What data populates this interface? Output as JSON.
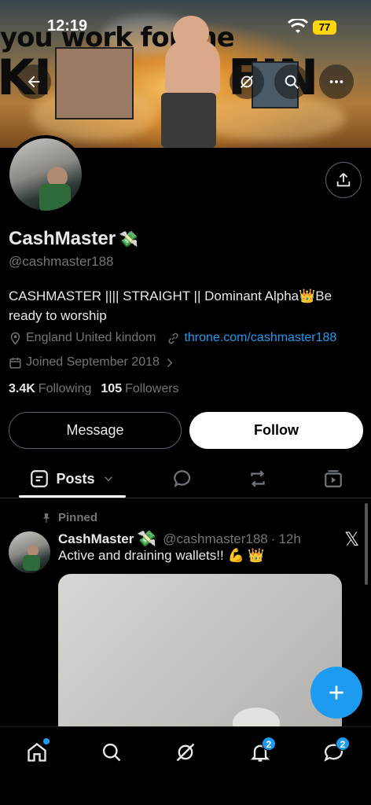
{
  "status_bar": {
    "time": "12:19",
    "battery": "77"
  },
  "banner": {
    "text_top": "you work for me",
    "text_left": "KING",
    "text_right": "FIN"
  },
  "profile": {
    "display_name": "CashMaster",
    "name_emoji": "💸",
    "handle": "@cashmaster188",
    "bio": "CASHMASTER |||| STRAIGHT || Dominant Alpha👑Be ready to worship",
    "location": "England United kindom",
    "website": "throne.com/cashmaster188",
    "joined": "Joined September 2018",
    "following_count": "3.4K",
    "following_label": "Following",
    "followers_count": "105",
    "followers_label": "Followers"
  },
  "actions": {
    "message_label": "Message",
    "follow_label": "Follow"
  },
  "tabs": {
    "posts_label": "Posts"
  },
  "pinned_post": {
    "pinned_label": "Pinned",
    "author_name": "CashMaster",
    "author_emoji": "💸",
    "author_handle": "@cashmaster188",
    "separator": "·",
    "time": "12h",
    "text": "Active and draining wallets!! 💪 👑"
  },
  "bottom_nav": {
    "notifications_badge": "2",
    "messages_badge": "2"
  },
  "colors": {
    "accent": "#1d9bf0",
    "background": "#000000",
    "secondary_text": "#71767b"
  }
}
